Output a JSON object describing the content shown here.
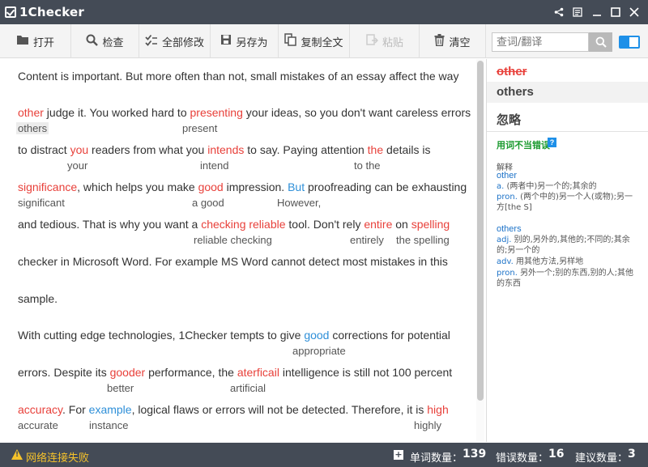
{
  "app": {
    "title": "1Checker"
  },
  "toolbar": {
    "open": "打开",
    "check": "检查",
    "fix_all": "全部修改",
    "save_as": "另存为",
    "copy_all": "复制全文",
    "paste": "粘贴",
    "clear": "清空",
    "search_placeholder": "查词/翻译"
  },
  "editor": {
    "paragraphs": [
      {
        "segments": [
          "Content is important. But more often than not, small mistakes of an essay affect the way"
        ],
        "suggestions": []
      },
      {
        "segments": [
          "other",
          " judge it. You worked hard to ",
          "presenting",
          " your ideas, so you don't want careless errors"
        ],
        "suggestions": [
          "others",
          "present"
        ]
      },
      {
        "segments": [
          "to distract ",
          "you",
          " readers from what you ",
          "intends",
          " to say. Paying attention ",
          "the",
          " details is"
        ],
        "suggestions": [
          "your",
          "intend",
          "to the"
        ]
      },
      {
        "segments": [
          "significance",
          ", which helps you make ",
          "good",
          " impression. ",
          "But",
          " proofreading can be exhausting"
        ],
        "suggestions": [
          "significant",
          "a good",
          "However,"
        ]
      },
      {
        "segments": [
          "and tedious. That is why you want a ",
          "checking reliable",
          " tool. Don't rely ",
          "entire",
          " on ",
          "spelling"
        ],
        "suggestions": [
          "reliable checking",
          "entirely",
          "the spelling"
        ]
      },
      {
        "segments": [
          "checker in Microsoft Word. For example MS Word cannot detect most mistakes in this"
        ],
        "suggestions": []
      },
      {
        "segments": [
          "sample."
        ],
        "suggestions": []
      },
      {
        "segments": [
          "With cutting edge technologies, 1Checker tempts to give ",
          "good",
          " corrections for potential"
        ],
        "suggestions": [
          "appropriate"
        ]
      },
      {
        "segments": [
          "errors. Despite its ",
          "gooder",
          " performance, the ",
          "aterficail",
          " intelligence is still not 100 percent"
        ],
        "suggestions": [
          "better",
          "artificial"
        ]
      },
      {
        "segments": [
          "accuracy",
          ". For ",
          "example",
          ", logical flaws or errors will not be detected. Therefore, it is ",
          "high"
        ],
        "suggestions": [
          "accurate",
          "instance",
          "highly"
        ]
      }
    ]
  },
  "panel": {
    "wrong_word": "other",
    "suggestion": "others",
    "ignore": "忽略",
    "error_type": "用词不当错误",
    "help": "?",
    "def_title": "解释",
    "entries": [
      {
        "word": "other",
        "defs": [
          {
            "pos": "a.",
            "text": "(两者中)另一个的;其余的"
          },
          {
            "pos": "pron.",
            "text": "(两个中的)另一个人(或物);另一方[the S]"
          }
        ]
      },
      {
        "word": "others",
        "defs": [
          {
            "pos": "adj.",
            "text": "别的,另外的,其他的;不同的;其余的;另一个的"
          },
          {
            "pos": "adv.",
            "text": "用其他方法,另样地"
          },
          {
            "pos": "pron.",
            "text": "另外一个;别的东西,别的人;其他的东西"
          }
        ]
      }
    ]
  },
  "status": {
    "network": "网络连接失败",
    "word_count_label": "单词数量：",
    "word_count": "139",
    "error_count_label": "错误数量：",
    "error_count": "16",
    "suggestion_count_label": "建议数量：",
    "suggestion_count": "3"
  },
  "colors": {
    "titlebar": "#444b56",
    "error": "#e8403a",
    "hint": "#2e8fd8",
    "accent": "#1e90e8",
    "warning": "#f5c22b"
  }
}
